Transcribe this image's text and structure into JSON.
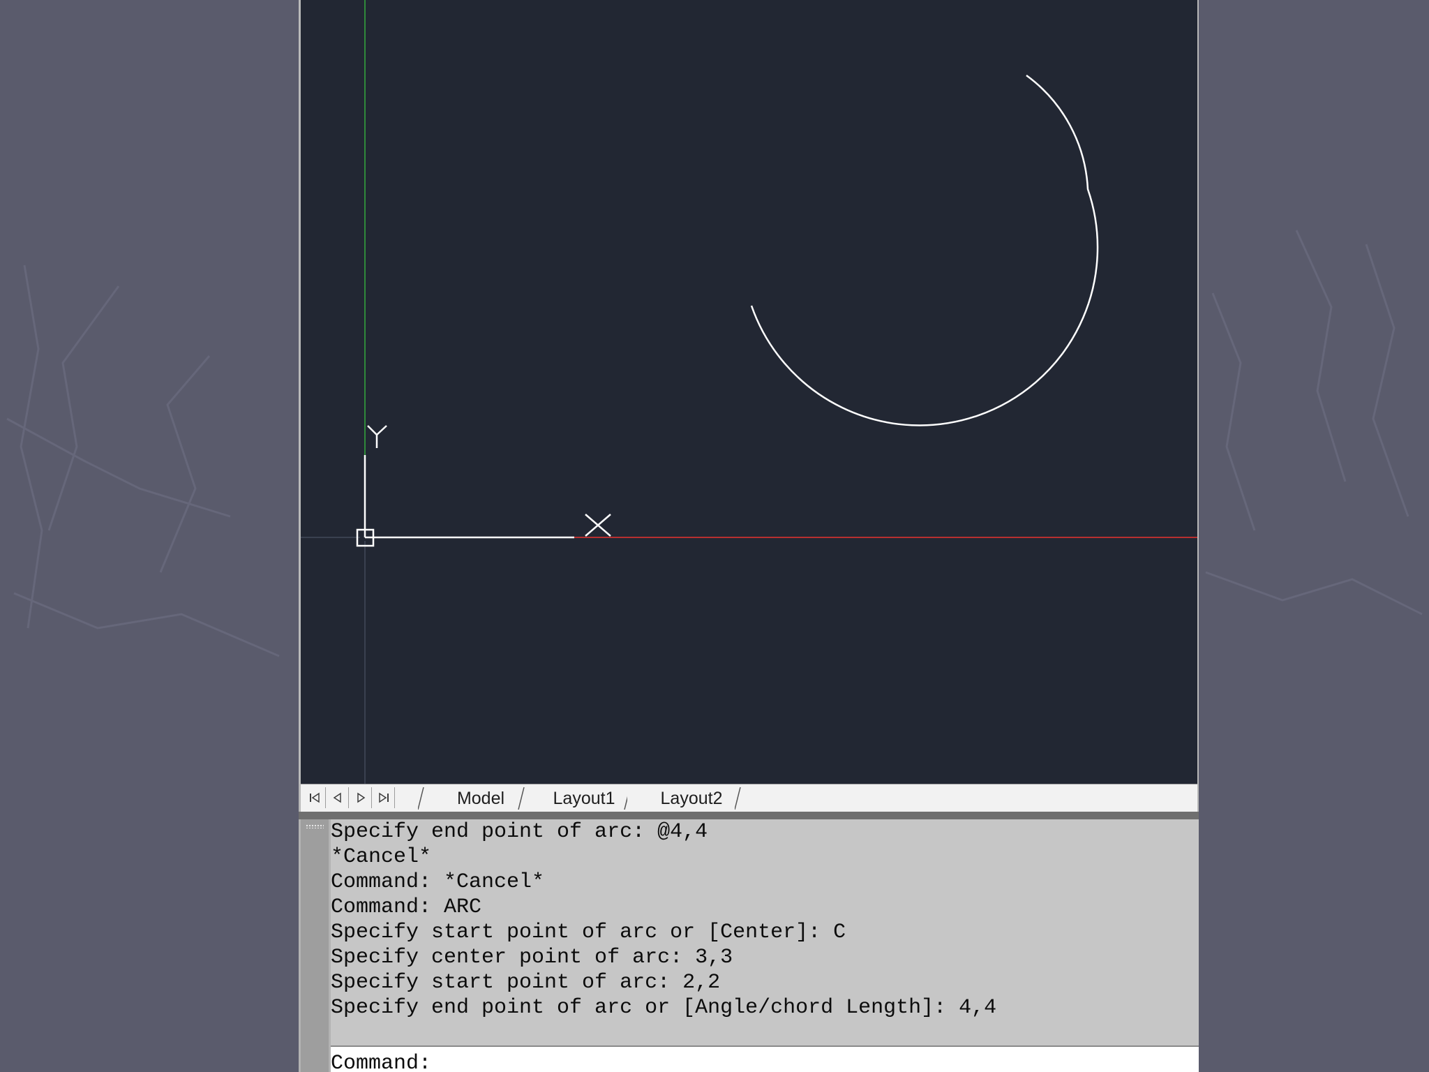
{
  "tabs": {
    "nav_first": "first-tab",
    "nav_prev": "previous-tab",
    "nav_next": "next-tab",
    "nav_last": "last-tab",
    "items": [
      {
        "label": "Model"
      },
      {
        "label": "Layout1"
      },
      {
        "label": "Layout2"
      }
    ]
  },
  "ucs": {
    "y_label": "Y"
  },
  "command_window": {
    "history": [
      "Specify end point of arc: @4,4",
      "*Cancel*",
      "Command: *Cancel*",
      "Command: ARC",
      "Specify start point of arc or [Center]: C",
      "Specify center point of arc: 3,3",
      "Specify start point of arc: 2,2",
      "Specify end point of arc or [Angle/chord Length]: 4,4"
    ],
    "prompt": "Command: "
  },
  "colors": {
    "canvas": "#222733",
    "x_axis": "#b83030",
    "y_axis": "#2f8a3a",
    "arc": "#ffffff"
  }
}
